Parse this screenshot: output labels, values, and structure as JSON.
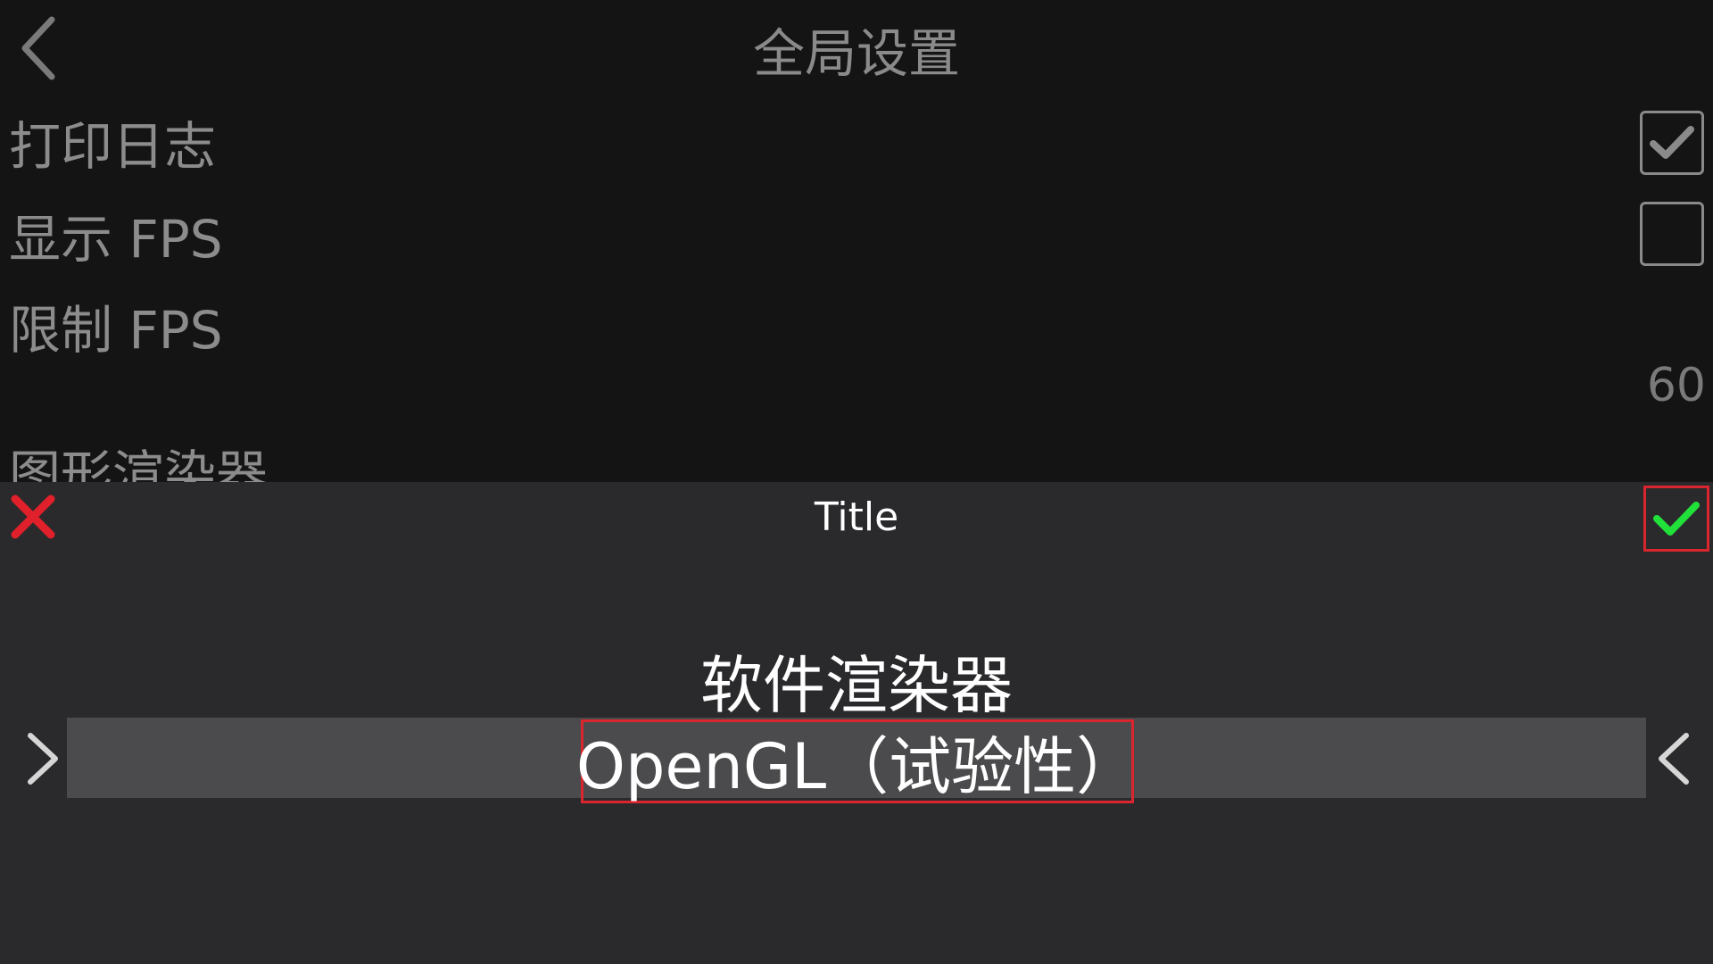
{
  "header": {
    "title": "全局设置",
    "back_icon": "chevron-left-icon"
  },
  "settings": {
    "log": {
      "label": "打印日志",
      "checked": true
    },
    "show_fps": {
      "label": "显示 FPS",
      "checked": false
    },
    "limit_fps": {
      "label": "限制 FPS",
      "value": "60"
    },
    "renderer": {
      "label": "图形渲染器"
    }
  },
  "dialog": {
    "title": "Title",
    "cancel_icon": "close-icon",
    "confirm_icon": "check-icon",
    "options": {
      "previous": "软件渲染器",
      "selected": "OpenGL（试验性）"
    },
    "prev_icon": "chevron-right-icon",
    "next_icon": "chevron-left-icon"
  },
  "colors": {
    "background": "#141414",
    "dialog_background": "#2a2a2c",
    "selected_bar": "#4b4b4d",
    "highlight_border": "#d9262e",
    "cancel_red": "#e0202a",
    "confirm_green": "#22e03a"
  }
}
